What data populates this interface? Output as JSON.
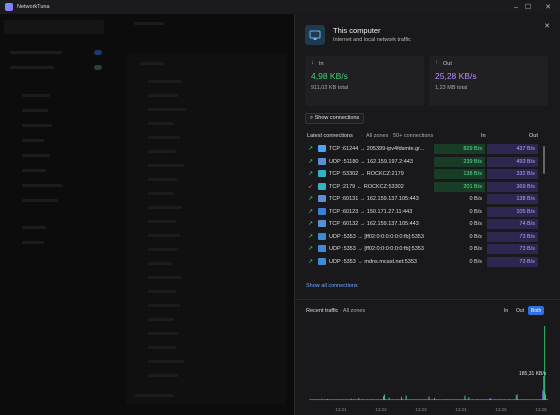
{
  "app": {
    "title": "NetworkTuna"
  },
  "window_controls": {
    "minimize": "–",
    "maximize": "☐",
    "close": "✕"
  },
  "panel": {
    "close": "✕",
    "title": "This computer",
    "subtitle": "Internet and local network traffic",
    "in_card": {
      "arrow": "↓",
      "label": "In",
      "value": "4,98 KB/s",
      "total": "911,02 KB total"
    },
    "out_card": {
      "arrow": "↑",
      "label": "Out",
      "value": "25,28 KB/s",
      "total": "1,23 MB total"
    },
    "show_connections": "⌕ Show connections",
    "conn_header": {
      "latest": "Latest connections",
      "sep": "·",
      "zone": "All zones",
      "count": "50+ connections",
      "in": "In",
      "out": "Out"
    },
    "connections": [
      {
        "dir": "↗",
        "icon": "cloud-icon",
        "text": "TCP :61244 → 205399-ipv4fdsmte.gr...",
        "in": "829 B/s",
        "out": "437 B/s",
        "in_level": 1.0,
        "out_level": 1.0
      },
      {
        "dir": "↗",
        "icon": "monitor-icon",
        "text": "UDP :51180 → 162.159.197.2:443",
        "in": "239 B/s",
        "out": "493 B/s",
        "in_level": 1.0,
        "out_level": 1.0
      },
      {
        "dir": "↗",
        "icon": "app-icon",
        "text": "TCP :53302 → ROCKCZ:2179",
        "in": "138 B/s",
        "out": "332 B/s",
        "in_level": 1.0,
        "out_level": 1.0
      },
      {
        "dir": "↙",
        "icon": "app-icon",
        "text": "TCP :2179 ← ROCKCZ:53302",
        "in": "201 B/s",
        "out": "369 B/s",
        "in_level": 1.0,
        "out_level": 1.0
      },
      {
        "dir": "↗",
        "icon": "monitor-icon",
        "text": "TCP :60131 → 162.159.137.105:443",
        "in": "0 B/s",
        "out": "138 B/s",
        "in_level": 0,
        "out_level": 1.0
      },
      {
        "dir": "↗",
        "icon": "window-icon",
        "text": "TCP :60123 → 150.171.27.11:443",
        "in": "0 B/s",
        "out": "105 B/s",
        "in_level": 0,
        "out_level": 1.0
      },
      {
        "dir": "↗",
        "icon": "monitor-icon",
        "text": "TCP :60132 → 162.159.137.105:443",
        "in": "0 B/s",
        "out": "74 B/s",
        "in_level": 0,
        "out_level": 1.0
      },
      {
        "dir": "↗",
        "icon": "globe-icon",
        "text": "UDP :5353 → [ff02:0:0:0:0:0:0:fb]:5353",
        "in": "0 B/s",
        "out": "73 B/s",
        "in_level": 0,
        "out_level": 1.0
      },
      {
        "dir": "↗",
        "icon": "globe-icon",
        "text": "UDP :5353 → [ff02:0:0:0:0:0:0:fb]:5353",
        "in": "0 B/s",
        "out": "73 B/s",
        "in_level": 0,
        "out_level": 1.0
      },
      {
        "dir": "↗",
        "icon": "globe-icon",
        "text": "UDP :5353 → mdns.mcast.net:5353",
        "in": "0 B/s",
        "out": "73 B/s",
        "in_level": 0,
        "out_level": 1.0
      }
    ],
    "show_all": "Show all connections",
    "traffic": {
      "title": "Recent traffic",
      "sep": "·",
      "zone": "All zones",
      "toggle_in": "In",
      "toggle_out": "Out",
      "toggle_both": "Both",
      "selected": "Both"
    }
  },
  "colors": {
    "in": "#3fcf7a",
    "out": "#9b7bff",
    "in_cell": "#173d27",
    "out_cell": "#2d2750",
    "accent": "#2f6fe0"
  },
  "chart_data": {
    "type": "bar",
    "title": "Recent traffic",
    "x_tick_labels": [
      "13:21",
      "13:22",
      "13:23",
      "13:24",
      "13:25",
      "13:26"
    ],
    "annotation": "185,31 KB/s",
    "series": [
      {
        "name": "In",
        "color": "#3fcf7a",
        "values": [
          0,
          0,
          0,
          0,
          0,
          0,
          0,
          0,
          0,
          0,
          0,
          0,
          0,
          0,
          0,
          0,
          0,
          0,
          0,
          2,
          0,
          0,
          0,
          0,
          0,
          0,
          0,
          0,
          0,
          0,
          0,
          0,
          0,
          0,
          0,
          0,
          0,
          0,
          0,
          0,
          0,
          0,
          0,
          0,
          3,
          0,
          0,
          0,
          0,
          0,
          0,
          0,
          4,
          0,
          0,
          0,
          0,
          0,
          0,
          0,
          0,
          0,
          0,
          0,
          0,
          0,
          0,
          0,
          0,
          0,
          0,
          0,
          0,
          0,
          0,
          0,
          0,
          0,
          8,
          12,
          0,
          0,
          0,
          0,
          5,
          0,
          0,
          0,
          0,
          0,
          0,
          0,
          0,
          0,
          0,
          0,
          0,
          6,
          0,
          0,
          0,
          0,
          10,
          0,
          0,
          0,
          0,
          0,
          0,
          0,
          0,
          0,
          0,
          0,
          0,
          0,
          0,
          0,
          0,
          0,
          0,
          0,
          0,
          0,
          0,
          0,
          7,
          0,
          0,
          0,
          0,
          0,
          4,
          0,
          0,
          0,
          0,
          0,
          0,
          0,
          0,
          0,
          0,
          0,
          0,
          0,
          0,
          0,
          0,
          0,
          0,
          0,
          0,
          0,
          0,
          0,
          0,
          0,
          0,
          0,
          0,
          0,
          0,
          0,
          9,
          0,
          0,
          0,
          6,
          0,
          0,
          0,
          0,
          0,
          0,
          0,
          0,
          0,
          0,
          0,
          0,
          0,
          0,
          0,
          0,
          0,
          0,
          0,
          0,
          0,
          3,
          0,
          0,
          0,
          0,
          0,
          0,
          0,
          0,
          0,
          0,
          0,
          0,
          0,
          0,
          0,
          0,
          0,
          0,
          0,
          0,
          0,
          0,
          0,
          0,
          0,
          0,
          0,
          12,
          0,
          0,
          0,
          0,
          0,
          0,
          0,
          0,
          0,
          0,
          0,
          0,
          0,
          0,
          0,
          0,
          0,
          0,
          0,
          0,
          0,
          0,
          0,
          0,
          0,
          0,
          0,
          0,
          20,
          185,
          14,
          0,
          0,
          0
        ]
      },
      {
        "name": "Out",
        "color": "#9b7bff",
        "values": [
          1,
          1,
          1,
          1,
          2,
          1,
          1,
          1,
          2,
          1,
          1,
          1,
          1,
          3,
          1,
          1,
          1,
          2,
          1,
          2,
          1,
          1,
          1,
          1,
          2,
          1,
          1,
          1,
          1,
          1,
          2,
          1,
          1,
          1,
          1,
          2,
          1,
          1,
          1,
          1,
          2,
          1,
          1,
          1,
          3,
          1,
          1,
          2,
          1,
          1,
          1,
          1,
          4,
          1,
          1,
          1,
          2,
          1,
          1,
          1,
          1,
          2,
          1,
          1,
          1,
          1,
          2,
          1,
          1,
          1,
          1,
          1,
          2,
          1,
          1,
          1,
          2,
          1,
          9,
          14,
          3,
          1,
          1,
          1,
          6,
          1,
          1,
          1,
          2,
          1,
          1,
          1,
          1,
          2,
          1,
          1,
          1,
          8,
          2,
          1,
          1,
          1,
          11,
          1,
          1,
          1,
          2,
          1,
          1,
          1,
          1,
          2,
          1,
          1,
          1,
          1,
          2,
          1,
          1,
          1,
          1,
          2,
          1,
          1,
          1,
          1,
          9,
          1,
          1,
          1,
          2,
          1,
          5,
          1,
          1,
          1,
          2,
          1,
          1,
          1,
          1,
          2,
          1,
          1,
          1,
          1,
          2,
          1,
          1,
          1,
          1,
          2,
          1,
          1,
          1,
          1,
          2,
          1,
          1,
          1,
          1,
          2,
          1,
          1,
          11,
          2,
          1,
          1,
          7,
          1,
          1,
          1,
          2,
          1,
          1,
          1,
          1,
          2,
          1,
          1,
          1,
          1,
          2,
          1,
          1,
          1,
          1,
          2,
          1,
          1,
          1,
          5,
          2,
          1,
          1,
          1,
          2,
          1,
          1,
          1,
          1,
          2,
          1,
          1,
          1,
          1,
          2,
          1,
          1,
          1,
          1,
          2,
          1,
          1,
          1,
          1,
          2,
          1,
          1,
          14,
          2,
          1,
          1,
          1,
          2,
          1,
          1,
          1,
          1,
          2,
          1,
          1,
          1,
          1,
          2,
          1,
          1,
          1,
          1,
          2,
          1,
          1,
          1,
          1,
          2,
          1,
          24,
          60,
          18,
          4,
          2,
          1
        ]
      }
    ],
    "legend": "none",
    "grid": false
  }
}
